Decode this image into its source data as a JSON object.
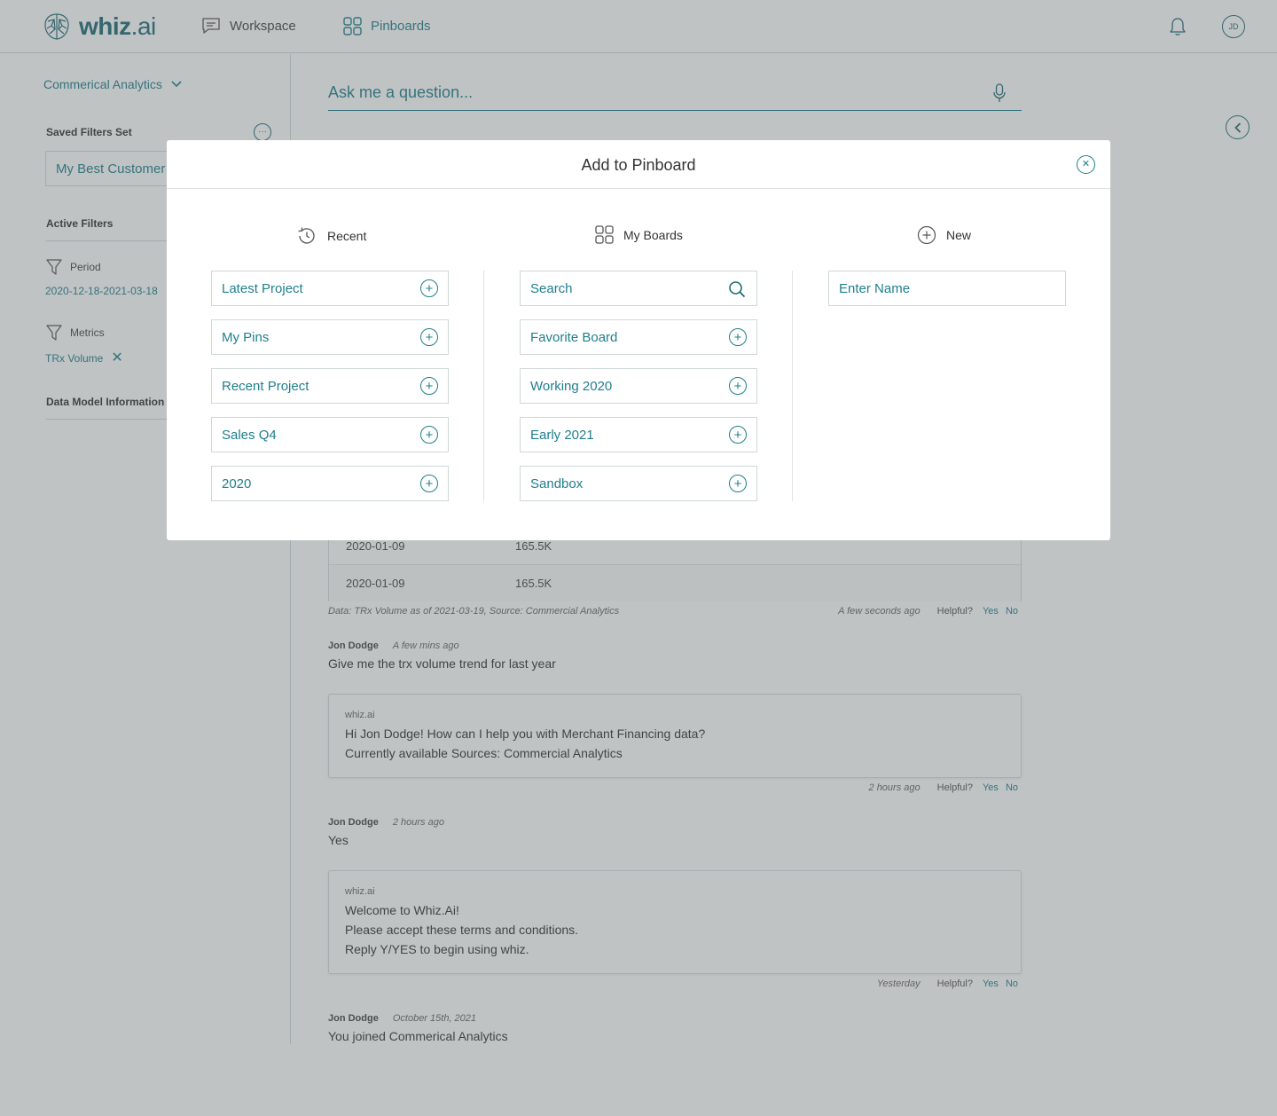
{
  "header": {
    "logo": {
      "light": "whiz",
      "dot": ".",
      "ai": "ai"
    },
    "nav": [
      {
        "label": "Workspace"
      },
      {
        "label": "Pinboards"
      }
    ],
    "avatar_initials": "JD",
    "accent_color": "#1f7f8c"
  },
  "sidebar": {
    "source_selector": "Commerical Analytics",
    "saved_filters_title": "Saved Filters Set",
    "saved_filter_value": "My Best Customer",
    "active_filters_title": "Active Filters",
    "filters": [
      {
        "label": "Period",
        "value": "2020-12-18-2021-03-18"
      },
      {
        "label": "Metrics",
        "value": "TRx Volume"
      }
    ],
    "data_model_title": "Data Model Information"
  },
  "main": {
    "ask_placeholder": "Ask me a question...",
    "table_rows": [
      {
        "date": "2020-01-09",
        "value": "165.5K"
      },
      {
        "date": "2020-01-09",
        "value": "165.5K"
      }
    ],
    "data_source_note": "Data: TRx Volume as of 2021-03-19, Source: Commercial Analytics",
    "helpful_label": "Helpful?",
    "yes_label": "Yes",
    "no_label": "No",
    "conversation": [
      {
        "answer_time": "A few seconds ago"
      },
      {
        "user": "Jon Dodge",
        "when": "A few mins ago",
        "text": "Give me the trx volume trend for last year"
      },
      {
        "from": "whiz.ai",
        "lines": [
          "Hi Jon Dodge! How can I help you with Merchant Financing data?",
          "Currently available Sources: Commercial Analytics"
        ],
        "answer_time": "2 hours ago"
      },
      {
        "user": "Jon Dodge",
        "when": "2 hours  ago",
        "text": "Yes"
      },
      {
        "from": "whiz.ai",
        "lines": [
          "Welcome to Whiz.Ai!",
          "Please accept these terms and conditions.",
          "Reply Y/YES to begin using whiz."
        ],
        "answer_time": "Yesterday"
      },
      {
        "user": "Jon Dodge",
        "when": "October 15th, 2021",
        "text": "You joined Commerical Analytics"
      }
    ]
  },
  "modal": {
    "title": "Add to Pinboard",
    "columns": {
      "recent": {
        "label": "Recent",
        "items": [
          "Latest Project",
          "My Pins",
          "Recent Project",
          "Sales Q4",
          "2020"
        ]
      },
      "my_boards": {
        "label": "My Boards",
        "search_placeholder": "Search",
        "items": [
          "Favorite Board",
          "Working 2020",
          "Early 2021",
          "Sandbox"
        ]
      },
      "new": {
        "label": "New",
        "name_placeholder": "Enter Name"
      }
    }
  }
}
